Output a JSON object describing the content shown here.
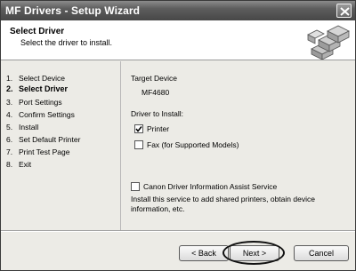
{
  "window": {
    "title": "MF Drivers - Setup Wizard",
    "close_icon": "close-icon"
  },
  "header": {
    "title": "Select Driver",
    "subtitle": "Select the driver to install.",
    "graphic_icon": "printers-graphic-icon"
  },
  "steps": [
    {
      "num": "1.",
      "label": "Select Device",
      "current": false
    },
    {
      "num": "2.",
      "label": "Select Driver",
      "current": true
    },
    {
      "num": "3.",
      "label": "Port Settings",
      "current": false
    },
    {
      "num": "4.",
      "label": "Confirm Settings",
      "current": false
    },
    {
      "num": "5.",
      "label": "Install",
      "current": false
    },
    {
      "num": "6.",
      "label": "Set Default Printer",
      "current": false
    },
    {
      "num": "7.",
      "label": "Print Test Page",
      "current": false
    },
    {
      "num": "8.",
      "label": "Exit",
      "current": false
    }
  ],
  "content": {
    "target_device_label": "Target Device",
    "target_device_value": "MF4680",
    "driver_to_install_label": "Driver to Install:",
    "printer_label": "Printer",
    "printer_checked": true,
    "fax_label": "Fax (for Supported Models)",
    "fax_checked": false,
    "assist_service_label": "Canon Driver Information Assist Service",
    "assist_service_checked": false,
    "assist_service_description": "Install this service to add shared printers, obtain device information, etc."
  },
  "buttons": {
    "back": "< Back",
    "next": "Next >",
    "cancel": "Cancel"
  }
}
